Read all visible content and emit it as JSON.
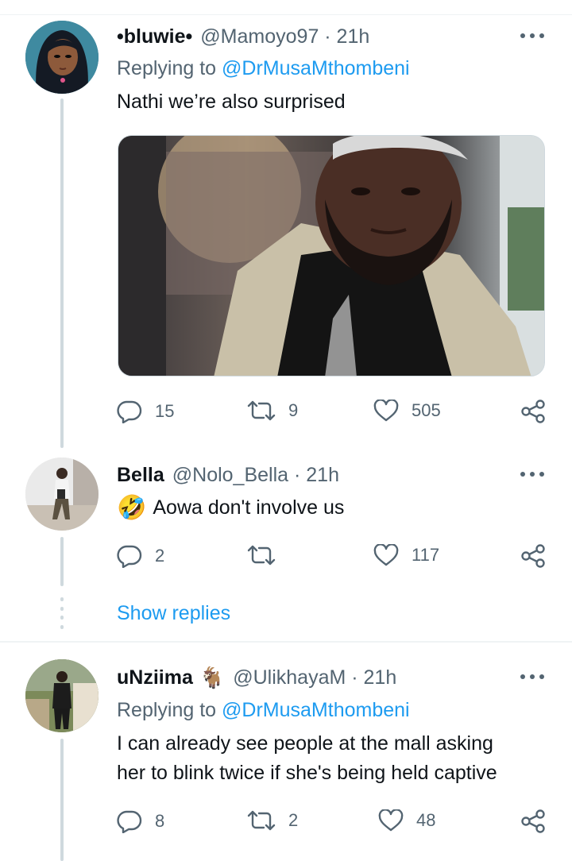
{
  "tweets": [
    {
      "display_name": "•bluwie•",
      "handle_time": "@Mamoyo97 · 21h",
      "replying_prefix": "Replying to ",
      "replying_handle": "@DrMusaMthombeni",
      "text": "Nathi we’re also surprised",
      "replies": "15",
      "retweets": "9",
      "likes": "505"
    },
    {
      "display_name": "Bella",
      "handle_time": "@Nolo_Bella · 21h",
      "text": "Aowa don't involve us",
      "emoji": "🤣",
      "replies": "2",
      "retweets": "",
      "likes": "117"
    },
    {
      "display_name": "uNziima",
      "emoji": "🐐",
      "handle_time": "@UlikhayaM · 21h",
      "replying_prefix": "Replying to ",
      "replying_handle": "@DrMusaMthombeni",
      "text_line1": "I can already see people at the mall asking",
      "text_line2": "her to blink twice if she's being held captive",
      "replies": "8",
      "retweets": "2",
      "likes": "48"
    }
  ],
  "show_replies_label": "Show replies",
  "colors": {
    "accent": "#1d9bf0",
    "secondary_text": "#536471",
    "primary_text": "#0f1419",
    "thread_line": "#cfd9de"
  }
}
